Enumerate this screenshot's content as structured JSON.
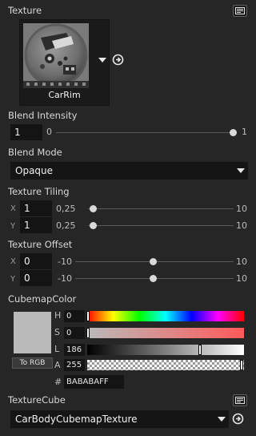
{
  "texture": {
    "label": "Texture",
    "thumbnail_name": "CarRim",
    "icon": "texture-browse-icon"
  },
  "blend_intensity": {
    "label": "Blend Intensity",
    "value": "1",
    "min": "0",
    "max": "1",
    "fraction": 1.0
  },
  "blend_mode": {
    "label": "Blend Mode",
    "selected": "Opaque"
  },
  "texture_tiling": {
    "label": "Texture Tiling",
    "x": {
      "axis": "X",
      "value": "1",
      "min": "0,25",
      "max": "10",
      "fraction": 0.077
    },
    "y": {
      "axis": "Y",
      "value": "1",
      "min": "0,25",
      "max": "10",
      "fraction": 0.077
    }
  },
  "texture_offset": {
    "label": "Texture Offset",
    "x": {
      "axis": "X",
      "value": "0",
      "min": "-10",
      "max": "10",
      "fraction": 0.5
    },
    "y": {
      "axis": "Y",
      "value": "0",
      "min": "-10",
      "max": "10",
      "fraction": 0.5
    }
  },
  "cubemap_color": {
    "label": "CubemapColor",
    "swatch_color": "#BABABA",
    "to_rgb_label": "To RGB",
    "h": {
      "label": "H",
      "value": "0",
      "fraction": 0.0
    },
    "s": {
      "label": "S",
      "value": "0",
      "fraction": 0.0
    },
    "l": {
      "label": "L",
      "value": "186",
      "fraction": 0.73
    },
    "a": {
      "label": "A",
      "value": "255",
      "fraction": 1.0
    },
    "hash_label": "#",
    "hex": "BABABAFF"
  },
  "texture_cube": {
    "label": "TextureCube",
    "selected": "CarBodyCubemapTexture"
  }
}
